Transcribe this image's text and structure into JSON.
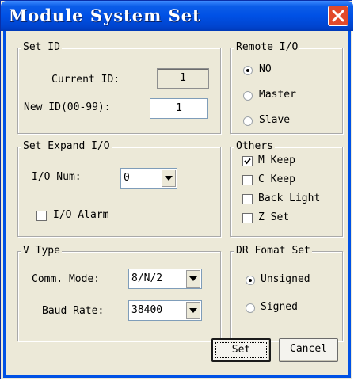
{
  "window": {
    "title": "Module System Set",
    "title_color": "#0051e5",
    "close_color": "#e24a2b"
  },
  "set_id": {
    "legend": "Set ID",
    "current_label": "Current ID:",
    "current_value": "1",
    "new_label": "New ID(00-99):",
    "new_value": "1"
  },
  "remote_io": {
    "legend": "Remote I/O",
    "options": [
      "NO",
      "Master",
      "Slave"
    ],
    "selected": "NO"
  },
  "set_expand": {
    "legend": "Set Expand I/O",
    "num_label": "I/O Num:",
    "num_value": "0",
    "alarm_label": "I/O Alarm",
    "alarm_checked": false
  },
  "others": {
    "legend": "Others",
    "items": [
      {
        "label": "M Keep",
        "checked": true
      },
      {
        "label": "C Keep",
        "checked": false
      },
      {
        "label": "Back Light",
        "checked": false
      },
      {
        "label": "Z Set",
        "checked": false
      }
    ]
  },
  "v_type": {
    "legend": "V Type",
    "comm_label": "Comm. Mode:",
    "comm_value": "8/N/2",
    "baud_label": "Baud Rate:",
    "baud_value": "38400"
  },
  "dr_format": {
    "legend": "DR Fomat Set",
    "options": [
      "Unsigned",
      "Signed"
    ],
    "selected": "Unsigned"
  },
  "buttons": {
    "set": "Set",
    "cancel": "Cancel"
  }
}
